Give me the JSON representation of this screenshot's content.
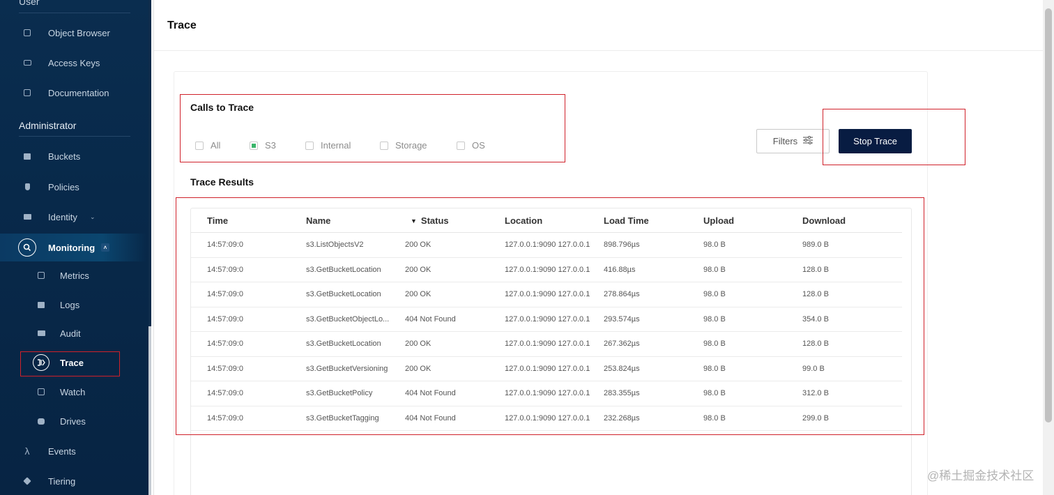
{
  "sidebar": {
    "user_label": "User",
    "admin_label": "Administrator",
    "user_items": [
      {
        "label": "Object Browser",
        "icon": "object-browser-icon"
      },
      {
        "label": "Access Keys",
        "icon": "key-icon"
      },
      {
        "label": "Documentation",
        "icon": "document-icon"
      }
    ],
    "admin_items": [
      {
        "label": "Buckets",
        "icon": "bucket-icon"
      },
      {
        "label": "Policies",
        "icon": "shield-icon"
      },
      {
        "label": "Identity",
        "icon": "identity-icon"
      },
      {
        "label": "Monitoring",
        "icon": "monitoring-icon"
      }
    ],
    "monitoring_items": [
      {
        "label": "Metrics",
        "icon": "metrics-icon"
      },
      {
        "label": "Logs",
        "icon": "logs-icon"
      },
      {
        "label": "Audit",
        "icon": "audit-icon"
      },
      {
        "label": "Trace",
        "icon": "trace-icon"
      },
      {
        "label": "Watch",
        "icon": "watch-icon"
      },
      {
        "label": "Drives",
        "icon": "drives-icon"
      }
    ],
    "bottom_items": [
      {
        "label": "Events",
        "icon": "lambda-icon"
      },
      {
        "label": "Tiering",
        "icon": "tiering-icon"
      }
    ]
  },
  "header": {
    "title": "Trace"
  },
  "calls_to_trace": {
    "title": "Calls to Trace",
    "options": [
      {
        "label": "All",
        "checked": false
      },
      {
        "label": "S3",
        "checked": true
      },
      {
        "label": "Internal",
        "checked": false
      },
      {
        "label": "Storage",
        "checked": false
      },
      {
        "label": "OS",
        "checked": false
      }
    ]
  },
  "buttons": {
    "filters": "Filters",
    "stop_trace": "Stop Trace"
  },
  "results": {
    "title": "Trace Results",
    "columns": [
      "Time",
      "Name",
      "Status",
      "Location",
      "Load Time",
      "Upload",
      "Download"
    ],
    "rows": [
      [
        "14:57:09:0",
        "s3.ListObjectsV2",
        "200 OK",
        "127.0.0.1:9090 127.0.0.1",
        "898.796µs",
        "98.0 B",
        "989.0 B"
      ],
      [
        "14:57:09:0",
        "s3.GetBucketLocation",
        "200 OK",
        "127.0.0.1:9090 127.0.0.1",
        "416.88µs",
        "98.0 B",
        "128.0 B"
      ],
      [
        "14:57:09:0",
        "s3.GetBucketLocation",
        "200 OK",
        "127.0.0.1:9090 127.0.0.1",
        "278.864µs",
        "98.0 B",
        "128.0 B"
      ],
      [
        "14:57:09:0",
        "s3.GetBucketObjectLo...",
        "404 Not Found",
        "127.0.0.1:9090 127.0.0.1",
        "293.574µs",
        "98.0 B",
        "354.0 B"
      ],
      [
        "14:57:09:0",
        "s3.GetBucketLocation",
        "200 OK",
        "127.0.0.1:9090 127.0.0.1",
        "267.362µs",
        "98.0 B",
        "128.0 B"
      ],
      [
        "14:57:09:0",
        "s3.GetBucketVersioning",
        "200 OK",
        "127.0.0.1:9090 127.0.0.1",
        "253.824µs",
        "98.0 B",
        "99.0 B"
      ],
      [
        "14:57:09:0",
        "s3.GetBucketPolicy",
        "404 Not Found",
        "127.0.0.1:9090 127.0.0.1",
        "283.355µs",
        "98.0 B",
        "312.0 B"
      ],
      [
        "14:57:09:0",
        "s3.GetBucketTagging",
        "404 Not Found",
        "127.0.0.1:9090 127.0.0.1",
        "232.268µs",
        "98.0 B",
        "299.0 B"
      ]
    ]
  },
  "watermark": "@稀土掘金技术社区",
  "colors": {
    "sidebar_bg": "#0a2d4f",
    "primary_button": "#081c42",
    "highlight_box": "#d0212a",
    "checkbox_checked": "#3bb56b"
  }
}
